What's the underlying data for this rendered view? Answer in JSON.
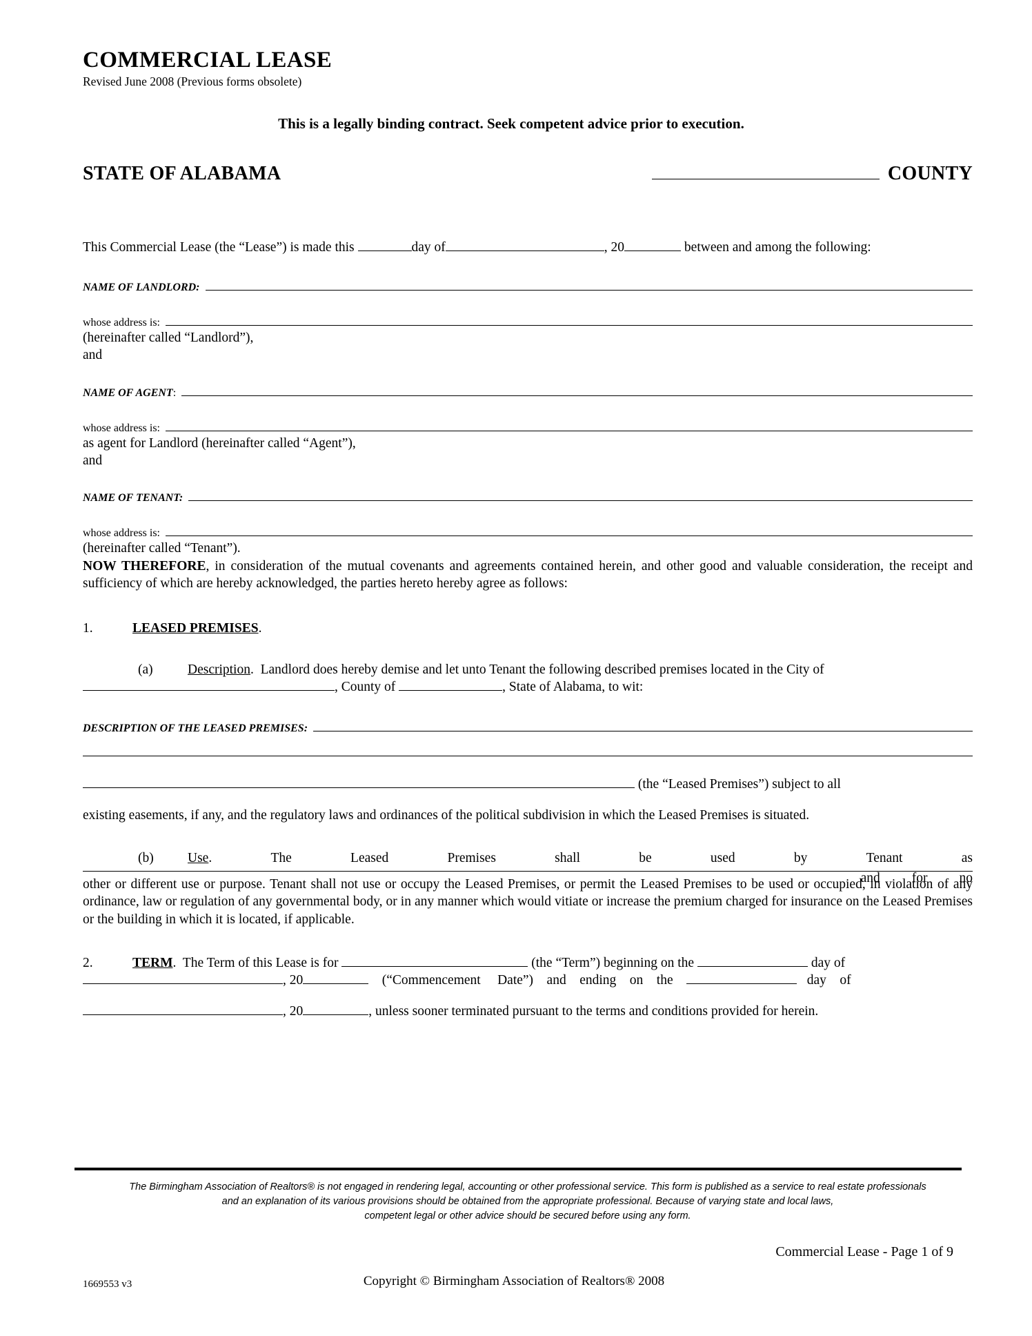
{
  "document": {
    "title": "COMMERCIAL LEASE",
    "revised": "Revised June 2008 (Previous forms obsolete)",
    "binding_notice": "This is a legally binding contract.  Seek competent advice prior to execution.",
    "state": "STATE OF ALABAMA",
    "county_word": "COUNTY"
  },
  "intro": {
    "lead": "This Commercial Lease (the “Lease”) is made this",
    "day_of": "day of",
    "year_prefix": ", 20",
    "tail": "between and among the following:"
  },
  "parties": {
    "landlord_label": "NAME OF LANDLORD:",
    "agent_label": "NAME OF AGENT",
    "agent_label_colon": ":",
    "tenant_label": "NAME OF TENANT:",
    "address_label": "whose address is:",
    "landlord_hereinafter": "(hereinafter called “Landlord”),",
    "agent_hereinafter": "as agent for Landlord (hereinafter called “Agent”),",
    "tenant_hereinafter": "(hereinafter called “Tenant”).",
    "and": "and"
  },
  "now_therefore": {
    "bold_lead": "NOW THEREFORE",
    "text": ", in consideration of the mutual covenants and agreements contained herein, and other good and valuable consideration, the receipt and sufficiency of which are hereby acknowledged, the parties hereto hereby agree as follows:"
  },
  "sections": {
    "s1": {
      "number": "1.",
      "heading": "LEASED PREMISES",
      "heading_period": ".",
      "a": {
        "letter": "(a)",
        "title": "Description",
        "title_period": ".",
        "text_1": "Landlord does hereby demise and let unto Tenant the following described premises located in the City of",
        "text_2a": ", County of",
        "text_2b": ", State of Alabama, to wit:",
        "description_label": "DESCRIPTION OF THE LEASED PREMISES:",
        "closing_1": "(the “Leased Premises”) subject to all",
        "closing_2": "existing easements, if any, and the regulatory laws and ordinances of the political subdivision in which the Leased Premises is situated."
      },
      "b": {
        "letter": "(b)",
        "title": "Use",
        "title_period": ".",
        "spread_words": [
          "The",
          "Leased",
          "Premises",
          "shall",
          "be",
          "used",
          "by",
          "Tenant",
          "as"
        ],
        "line2_right": [
          "and",
          "for",
          "no"
        ],
        "text": "other or different use or purpose.  Tenant shall not use or occupy the Leased Premises, or permit the Leased Premises to be used or occupied, in violation of any ordinance, law or regulation of any governmental body, or in any manner which would vitiate or increase the premium charged for insurance on the Leased Premises or the building in which it is located, if applicable."
      }
    },
    "s2": {
      "number": "2.",
      "heading": "TERM",
      "heading_period": ".",
      "text_1": "The Term of this Lease is for",
      "text_2": "(the “Term”) beginning on the",
      "text_3": "day of",
      "year_prefix": ",  20",
      "text_4": "(“Commencement",
      "text_4b": "Date”)",
      "text_5": "and",
      "text_6": "ending",
      "text_7": "on",
      "text_8": "the",
      "text_9": "day",
      "text_10": "of",
      "year_prefix_2": ", 20",
      "text_11": ", unless sooner terminated pursuant to the terms and conditions provided for herein."
    }
  },
  "footer": {
    "disclaimer_line_1": "The Birmingham Association of Realtors® is not engaged in rendering legal, accounting or other professional service.  This form is published as a service to real estate professionals",
    "disclaimer_line_2": "and an explanation of its various provisions should be obtained from the appropriate professional.  Because of varying state and local laws,",
    "disclaimer_line_3": "competent legal or other advice should be secured before using any form.",
    "page_label": "Commercial Lease - Page 1 of 9",
    "copyright": "Copyright © Birmingham Association of Realtors® 2008",
    "doc_id": "1669553 v3"
  }
}
